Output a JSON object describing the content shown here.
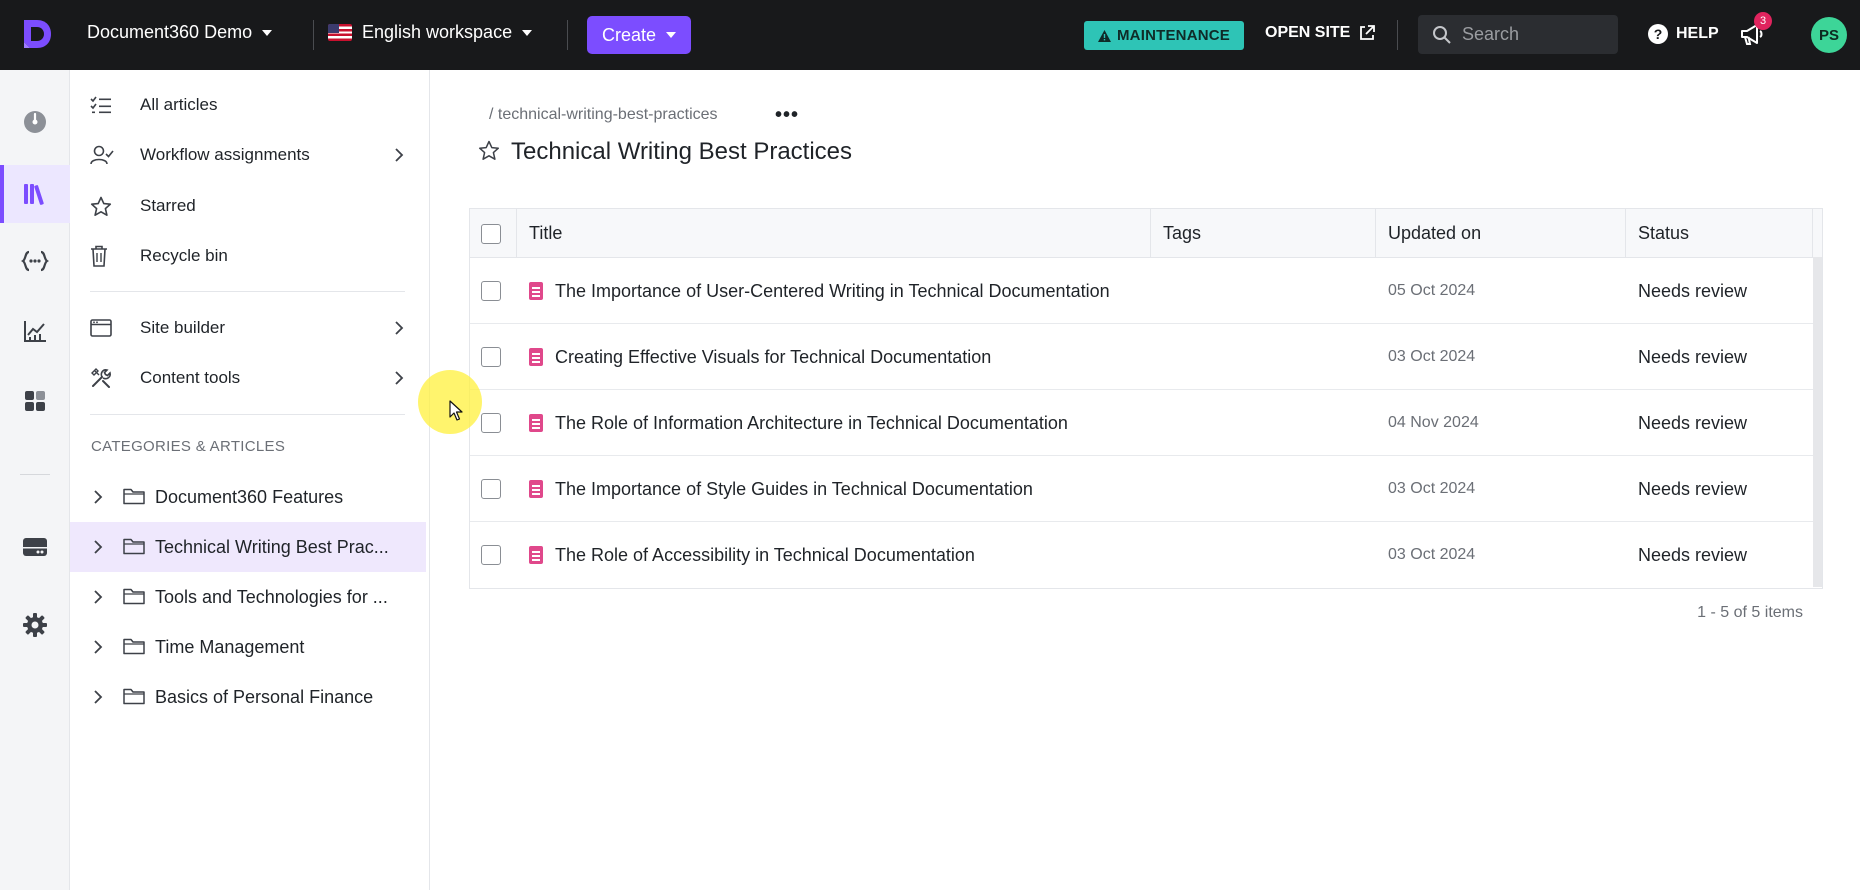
{
  "topbar": {
    "project_name": "Document360 Demo",
    "workspace": "English workspace",
    "create_label": "Create",
    "maintenance_label": "MAINTENANCE",
    "open_site_label": "OPEN SITE",
    "search_placeholder": "Search",
    "help_label": "HELP",
    "notification_count": "3",
    "avatar_initials": "PS"
  },
  "rail": {
    "items": [
      "dashboard-icon",
      "knowledge-base-icon",
      "api-docs-icon",
      "analytics-icon",
      "widgets-icon",
      "drive-icon",
      "settings-icon"
    ],
    "active": "knowledge-base-icon"
  },
  "sidebar": {
    "nav": [
      {
        "label": "All articles",
        "icon": "list-check-icon"
      },
      {
        "label": "Workflow assignments",
        "icon": "user-check-icon"
      },
      {
        "label": "Starred",
        "icon": "star-icon"
      },
      {
        "label": "Recycle bin",
        "icon": "trash-icon"
      },
      {
        "label": "Site builder",
        "icon": "browser-window-icon"
      },
      {
        "label": "Content tools",
        "icon": "tools-icon"
      }
    ],
    "section_title": "CATEGORIES & ARTICLES",
    "categories": [
      {
        "name": "Document360 Features",
        "active": false
      },
      {
        "name": "Technical Writing Best Prac...",
        "active": true
      },
      {
        "name": "Tools and Technologies for ...",
        "active": false
      },
      {
        "name": "Time Management",
        "active": false
      },
      {
        "name": "Basics of Personal Finance",
        "active": false
      }
    ]
  },
  "main": {
    "breadcrumb": "/ technical-writing-best-practices",
    "more_label": "•••",
    "title": "Technical Writing Best Practices",
    "columns": [
      "Title",
      "Tags",
      "Updated on",
      "Status"
    ],
    "rows": [
      {
        "title": "The Importance of User-Centered Writing in Technical Documentation",
        "tags": "",
        "updated": "05 Oct 2024",
        "status": "Needs review"
      },
      {
        "title": "Creating Effective Visuals for Technical Documentation",
        "tags": "",
        "updated": "03 Oct 2024",
        "status": "Needs review"
      },
      {
        "title": "The Role of Information Architecture in Technical Documentation",
        "tags": "",
        "updated": "04 Nov 2024",
        "status": "Needs review"
      },
      {
        "title": "The Importance of Style Guides in Technical Documentation",
        "tags": "",
        "updated": "03 Oct 2024",
        "status": "Needs review"
      },
      {
        "title": "The Role of Accessibility in Technical Documentation",
        "tags": "",
        "updated": "03 Oct 2024",
        "status": "Needs review"
      }
    ],
    "pagination": "1 - 5 of 5 items"
  },
  "colors": {
    "accent": "#7c4dff",
    "topbar_bg": "#18191b",
    "maintenance_bg": "#2ec4b6",
    "article_icon": "#e0488b",
    "avatar_bg": "#3dd598",
    "active_category_bg": "#efe8fd"
  }
}
